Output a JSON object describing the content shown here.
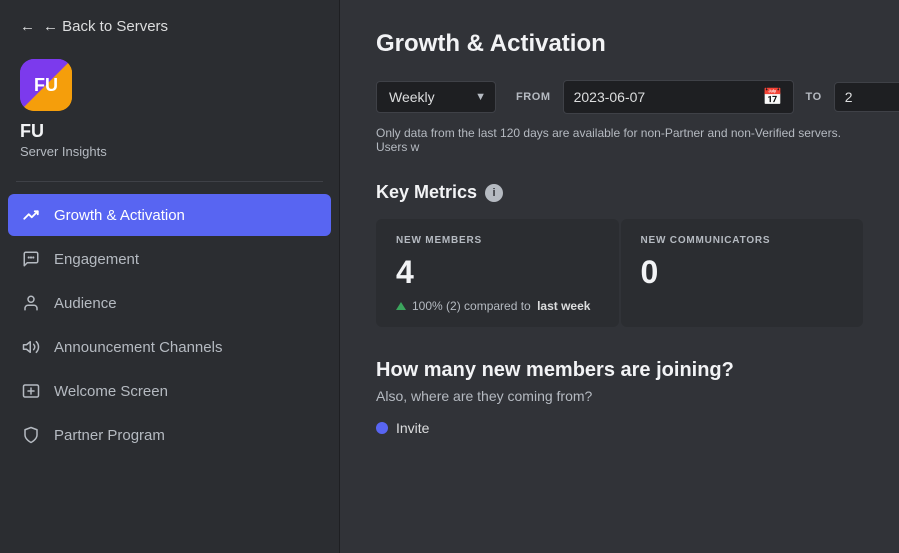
{
  "sidebar": {
    "back_label": "← Back to Servers",
    "server_icon_text": "FU",
    "server_name": "FU",
    "server_subtitle": "Server Insights",
    "nav_items": [
      {
        "id": "growth",
        "label": "Growth & Activation",
        "icon": "📈",
        "active": true
      },
      {
        "id": "engagement",
        "label": "Engagement",
        "icon": "💬",
        "active": false
      },
      {
        "id": "audience",
        "label": "Audience",
        "icon": "👤",
        "active": false
      },
      {
        "id": "announcement",
        "label": "Announcement Channels",
        "icon": "📡",
        "active": false
      },
      {
        "id": "welcome",
        "label": "Welcome Screen",
        "icon": "🎫",
        "active": false
      },
      {
        "id": "partner",
        "label": "Partner Program",
        "icon": "🛡️",
        "active": false
      }
    ]
  },
  "main": {
    "page_title": "Growth & Activation",
    "filter": {
      "period_label": "Weekly",
      "from_label": "FROM",
      "from_date": "2023-06-07",
      "to_label": "TO",
      "to_date_partial": "2"
    },
    "data_notice": "Only data from the last 120 days are available for non-Partner and non-Verified servers. Users w",
    "key_metrics": {
      "title": "Key Metrics",
      "cards": [
        {
          "label": "NEW MEMBERS",
          "value": "4",
          "change": "100% (2) compared to",
          "change_period": "last week"
        },
        {
          "label": "NEW COMMUNICATORS",
          "value": "0",
          "change": ""
        }
      ]
    },
    "joining_section": {
      "title": "How many new members are joining?",
      "subtitle": "Also, where are they coming from?",
      "legend": [
        {
          "label": "Invite",
          "color": "#5865f2"
        }
      ]
    }
  }
}
